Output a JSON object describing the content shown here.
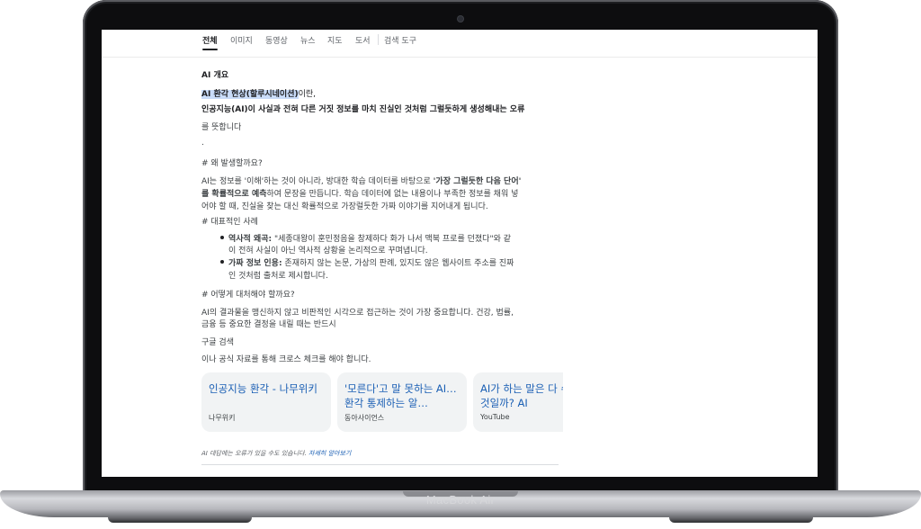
{
  "device": {
    "brand": "MacBook Air"
  },
  "tabs": [
    "전체",
    "이미지",
    "동영상",
    "뉴스",
    "지도",
    "도서",
    "검색 도구"
  ],
  "overview": {
    "heading": "AI 개요",
    "highlight_term": "AI 환각 현상(할루시네이션)",
    "term_suffix": "이란,",
    "definition_bold": "인공지능(AI)이 사실과 전혀 다른 거짓 정보를 마치 진실인 것처럼 그럴듯하게 생성해내는 오류",
    "definition_end": "를 뜻합니다",
    "dot": ".",
    "why_heading": "# 왜 발생할까요?",
    "why_p1_a": "AI는 정보를 '이해'하는 것이 아니라, 방대한 학습 데이터를 바탕으로 ",
    "why_p1_b": "'가장 그럴듯한 다음 단어'",
    "why_p2_a": "를 확률적으로 예측",
    "why_p2_b": "하여 문장을 만듭니다. 학습 데이터에 없는 내용이나 부족한 정보를 채워 넣",
    "why_p3": "어야 할 때, 진실을 찾는 대신 확률적으로 가장럴듯한 가짜 이야기를 지어내게 됩니다.",
    "examples_heading": "# 대표적인 사례",
    "ex1_label": "역사적 왜곡:",
    "ex1_text": " \"세종대왕이 훈민정음을 창제하다 화가 나서 맥북 프로를 던졌다\"와 같",
    "ex1_text2": "이 전혀 사실이 아닌 역사적 상황을 논리적으로 꾸며냅니다.",
    "ex2_label": "가짜 정보 인용:",
    "ex2_text": " 존재하지 않는 논문, 가상의 판례, 있지도 않은 웹사이트 주소를 진짜",
    "ex2_text2": "인 것처럼 출처로 제시합니다.",
    "how_heading": "# 어떻게 대처해야 할까요?",
    "how_p1": "AI의 결과물을 맹신하지 않고 비판적인 시각으로 접근하는 것이 가장 중요합니다. 건강, 법률,",
    "how_p2": "금융 등 중요한 결정을 내릴 때는 반드시",
    "google_search": "구글 검색",
    "cross_check": "이나 공식 자료를 통해 크로스 체크를 해야 합니다."
  },
  "sources": [
    {
      "title": "인공지능 환각 - 나무위키",
      "source": "나무위키"
    },
    {
      "title": "'모른다'고 말 못하는 AI…환각 통제하는 알…",
      "source": "동아사이언스"
    },
    {
      "title": "AI가 하는 말은 다 수 있는 것일까? AI",
      "source": "YouTube"
    }
  ],
  "footer": {
    "disclaimer": "AI 대답에는 오류가 있을 수도 있습니다.",
    "learn_more": "자세히 알아보기"
  }
}
